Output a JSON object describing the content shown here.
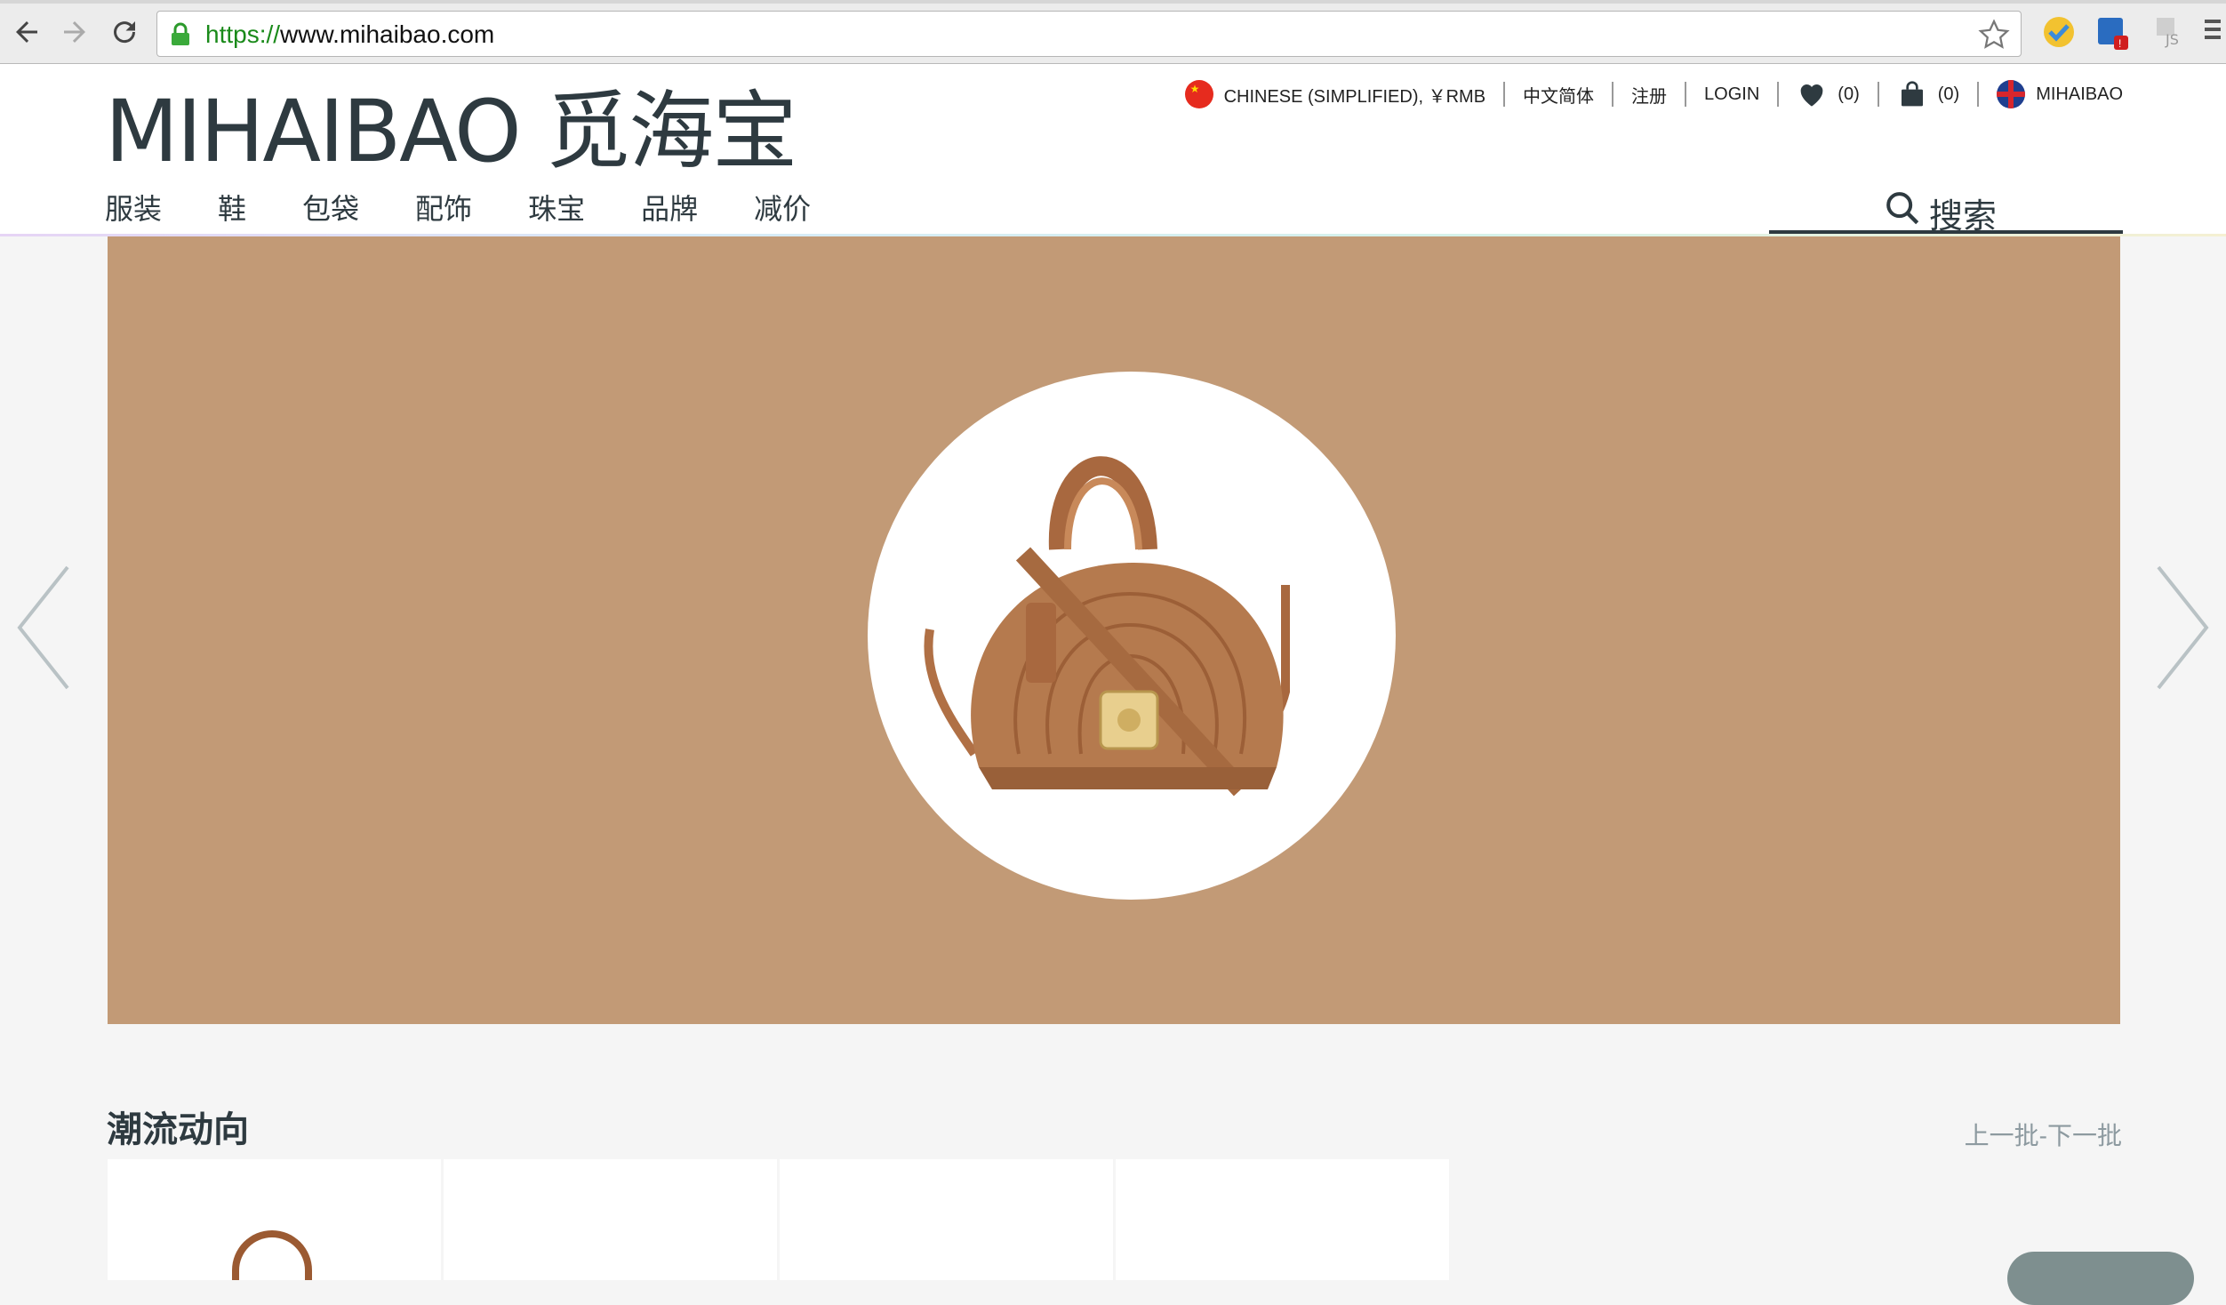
{
  "browser": {
    "url_scheme": "https://",
    "url_rest": "www.mihaibao.com"
  },
  "header": {
    "logo_text": "MIHAIBAO 觅海宝",
    "locale_label": "CHINESE (SIMPLIFIED), ￥RMB",
    "language_label": "中文简体",
    "register_label": "注册",
    "login_label": "LOGIN",
    "wishlist_count": "(0)",
    "cart_count": "(0)",
    "region_label": "MIHAIBAO"
  },
  "nav": {
    "items": [
      "服装",
      "鞋",
      "包袋",
      "配饰",
      "珠宝",
      "品牌",
      "减价"
    ],
    "search_label": "搜索"
  },
  "hero": {
    "background_color": "#c29a76",
    "image": "brown-handbag"
  },
  "trends": {
    "title": "潮流动向",
    "prev_label": "上一批",
    "separator": " - ",
    "next_label": "下一批"
  },
  "colors": {
    "brand_text": "#2e3a40",
    "accent_hero": "#c29a76"
  }
}
